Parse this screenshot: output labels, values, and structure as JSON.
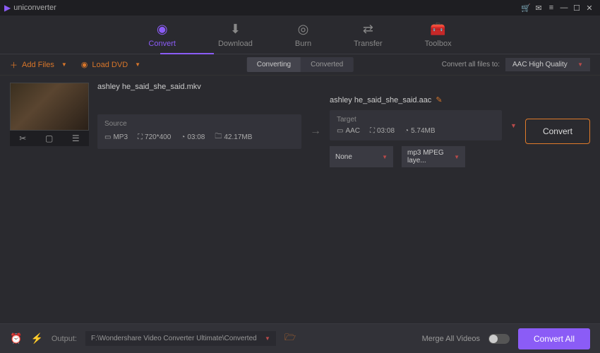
{
  "app": {
    "title": "uniconverter"
  },
  "tabs": [
    {
      "label": "Convert",
      "active": true
    },
    {
      "label": "Download",
      "active": false
    },
    {
      "label": "Burn",
      "active": false
    },
    {
      "label": "Transfer",
      "active": false
    },
    {
      "label": "Toolbox",
      "active": false
    }
  ],
  "toolbar": {
    "add_files": "Add Files",
    "load_dvd": "Load DVD",
    "segment": {
      "converting": "Converting",
      "converted": "Converted",
      "active": "converting"
    },
    "convert_all_label": "Convert all files to:",
    "format_selected": "AAC High Quality"
  },
  "item": {
    "source_filename": "ashley he_said_she_said.mkv",
    "target_filename": "ashley he_said_she_said.aac",
    "source": {
      "title": "Source",
      "codec": "MP3",
      "resolution": "720*400",
      "duration": "03:08",
      "size": "42.17MB"
    },
    "target": {
      "title": "Target",
      "codec": "AAC",
      "duration": "03:08",
      "size": "5.74MB"
    },
    "convert_label": "Convert",
    "sub_select_1": "None",
    "sub_select_2": "mp3 MPEG laye..."
  },
  "footer": {
    "output_label": "Output:",
    "output_path": "F:\\Wondershare Video Converter Ultimate\\Converted",
    "merge_label": "Merge All Videos",
    "convert_all": "Convert All"
  }
}
